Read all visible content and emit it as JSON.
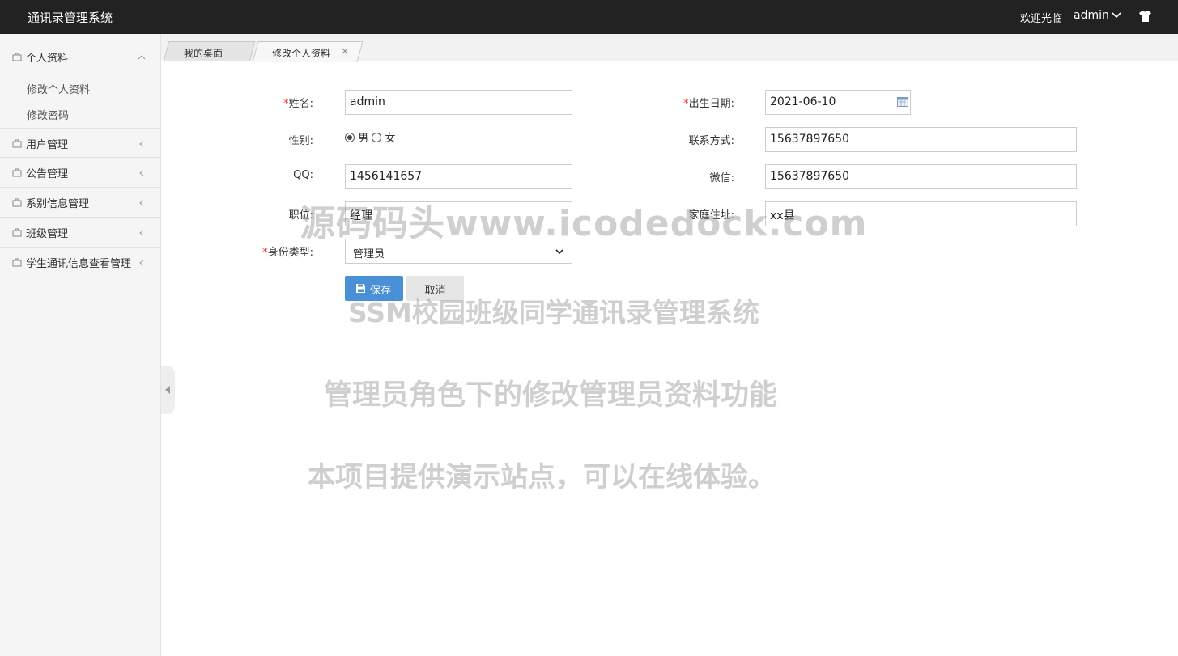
{
  "header": {
    "app_title": "通讯录管理系统",
    "welcome": "欢迎光临",
    "username": "admin"
  },
  "sidebar": {
    "groups": [
      {
        "label": "个人资料",
        "expanded": true,
        "children": [
          "修改个人资料",
          "修改密码"
        ]
      },
      {
        "label": "用户管理",
        "expanded": false
      },
      {
        "label": "公告管理",
        "expanded": false
      },
      {
        "label": "系别信息管理",
        "expanded": false
      },
      {
        "label": "班级管理",
        "expanded": false
      },
      {
        "label": "学生通讯信息查看管理",
        "expanded": false
      }
    ]
  },
  "tabs": [
    {
      "label": "我的桌面",
      "active": false
    },
    {
      "label": "修改个人资料",
      "active": true,
      "close": "×"
    }
  ],
  "form": {
    "name": {
      "label": "姓名:",
      "required_mark": "*",
      "value": "admin"
    },
    "birth": {
      "label": "出生日期:",
      "required_mark": "*",
      "value": "2021-06-10"
    },
    "gender": {
      "label": "性别:",
      "options": [
        "男",
        "女"
      ],
      "selected": "男"
    },
    "phone": {
      "label": "联系方式:",
      "value": "15637897650"
    },
    "qq": {
      "label": "QQ:",
      "value": "1456141657"
    },
    "wechat": {
      "label": "微信:",
      "value": "15637897650"
    },
    "position": {
      "label": "职位:",
      "value": "经理"
    },
    "address": {
      "label": "家庭住址:",
      "value": "xx县"
    },
    "identity": {
      "label": "身份类型:",
      "required_mark": "*",
      "value": "管理员"
    },
    "save_label": "保存",
    "cancel_label": "取消"
  },
  "watermark": {
    "line1": "源码码头www.icodedock.com",
    "line2": "SSM校园班级同学通讯录管理系统",
    "line3": "管理员角色下的修改管理员资料功能",
    "line4": "本项目提供演示站点，可以在线体验。"
  },
  "colors": {
    "topbar": "#222222",
    "primary_button": "#4a90d6",
    "required": "#ee3333"
  }
}
